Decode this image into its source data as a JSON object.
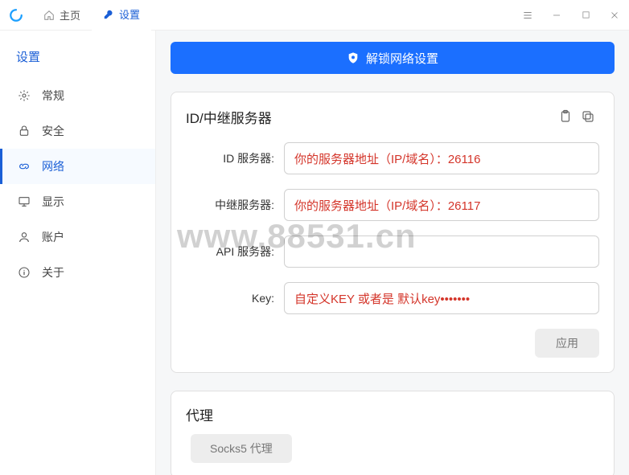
{
  "titlebar": {
    "tab_home": "主页",
    "tab_settings": "设置"
  },
  "sidebar": {
    "title": "设置",
    "items": [
      {
        "label": "常规"
      },
      {
        "label": "安全"
      },
      {
        "label": "网络"
      },
      {
        "label": "显示"
      },
      {
        "label": "账户"
      },
      {
        "label": "关于"
      }
    ]
  },
  "main": {
    "unlock_label": "解锁网络设置",
    "relay_card": {
      "title": "ID/中继服务器",
      "id_server_label": "ID 服务器:",
      "id_server_value": "你的服务器地址（IP/域名）：26116",
      "relay_server_label": "中继服务器:",
      "relay_server_value": "你的服务器地址（IP/域名）：26117",
      "api_server_label": "API 服务器:",
      "api_server_value": "",
      "key_label": "Key:",
      "key_value": "自定义KEY 或者是 默认key•••••••",
      "apply_label": "应用"
    },
    "proxy_card": {
      "title": "代理",
      "socks5_label": "Socks5 代理"
    }
  },
  "watermark": "www.88531.cn"
}
